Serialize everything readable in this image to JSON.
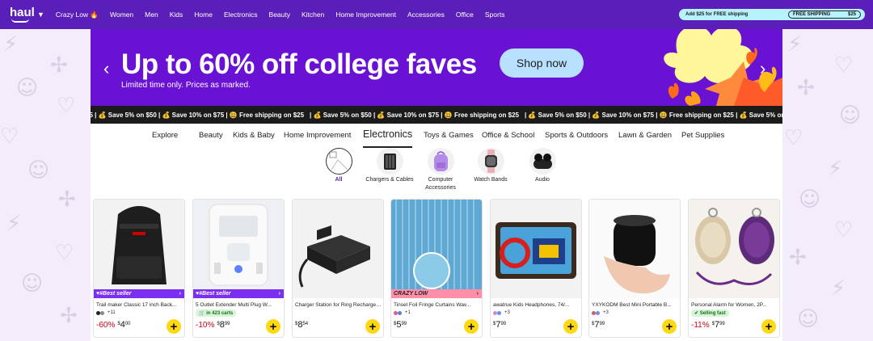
{
  "nav": {
    "logo": "haul",
    "links": [
      "Crazy Low 🔥",
      "Women",
      "Men",
      "Kids",
      "Home",
      "Electronics",
      "Beauty",
      "Kitchen",
      "Home Improvement",
      "Accessories",
      "Office",
      "Sports"
    ],
    "shipping": {
      "add_text": "Add $25 for FREE shipping",
      "label": "FREE SHIPPING",
      "amount": "$25"
    }
  },
  "hero": {
    "headline": "Up to 60% off college faves",
    "subtitle": "Limited time only. Prices as marked.",
    "cta": "Shop now",
    "accent": "#6a12d4"
  },
  "ticker": [
    "25 | 💰 Save 5% on $50 | 💰 Save 10% on $75 | 😃 Free shipping on $25",
    "| 💰 Save 5% on $50 | 💰 Save 10% on $75 | 😃 Free shipping on $25",
    "| 💰 Save 5% on $50 | 💰 Save 10% on $75 | 😃 Free shipping on $25 | 💰 Save 5% on $50 | 💰 Save 10% on $75 | 😃 Free shipping on $25 |"
  ],
  "categories": [
    "Explore",
    "Beauty",
    "Kids & Baby",
    "Home Improvement",
    "Electronics",
    "Toys & Games",
    "Office & School",
    "Sports & Outdoors",
    "Lawn & Garden",
    "Pet Supplies"
  ],
  "active_category": "Electronics",
  "subcategories": [
    "All",
    "Chargers & Cables",
    "Computer Accessories",
    "Watch Bands",
    "Audio"
  ],
  "products": [
    {
      "title": "Trail maker Classic 17 inch Back...",
      "tag": "#Best seller",
      "meta": "+11",
      "discount": "-60%",
      "dollars": "4",
      "cents": "00",
      "add": "+"
    },
    {
      "title": "5 Outlet Extender Multi Plug W...",
      "tag": "#Best seller",
      "badge": "in 423 carts",
      "discount": "-10%",
      "dollars": "8",
      "cents": "99",
      "add": "+"
    },
    {
      "title": "Charger Station for Ring Rechargeable Battery, Dual Por...",
      "dollars": "8",
      "cents": "54",
      "add": "+"
    },
    {
      "title": "Tinsel Foil Fringe Curtains Wav...",
      "tag": "CRAZY LOW",
      "meta": "+1",
      "dollars": "5",
      "cents": "99",
      "add": "+"
    },
    {
      "title": "awatrue Kids Headphones, 74/...",
      "meta": "+3",
      "dollars": "7",
      "cents": "99",
      "add": "+"
    },
    {
      "title": "YXYKODM Best Mini Portable B...",
      "meta": "+3",
      "dollars": "7",
      "cents": "99",
      "add": "+"
    },
    {
      "title": "Personal Alarm for Women, 2P...",
      "badge": "Selling fast",
      "discount": "-11%",
      "dollars": "7",
      "cents": "99",
      "add": "+"
    }
  ],
  "colors": {
    "nav": "#5a1fb8",
    "best_seller": "#7b2ff0",
    "crazy_low": "#ff8fa8",
    "add_button": "#ffd814",
    "discount": "#d0021b"
  }
}
